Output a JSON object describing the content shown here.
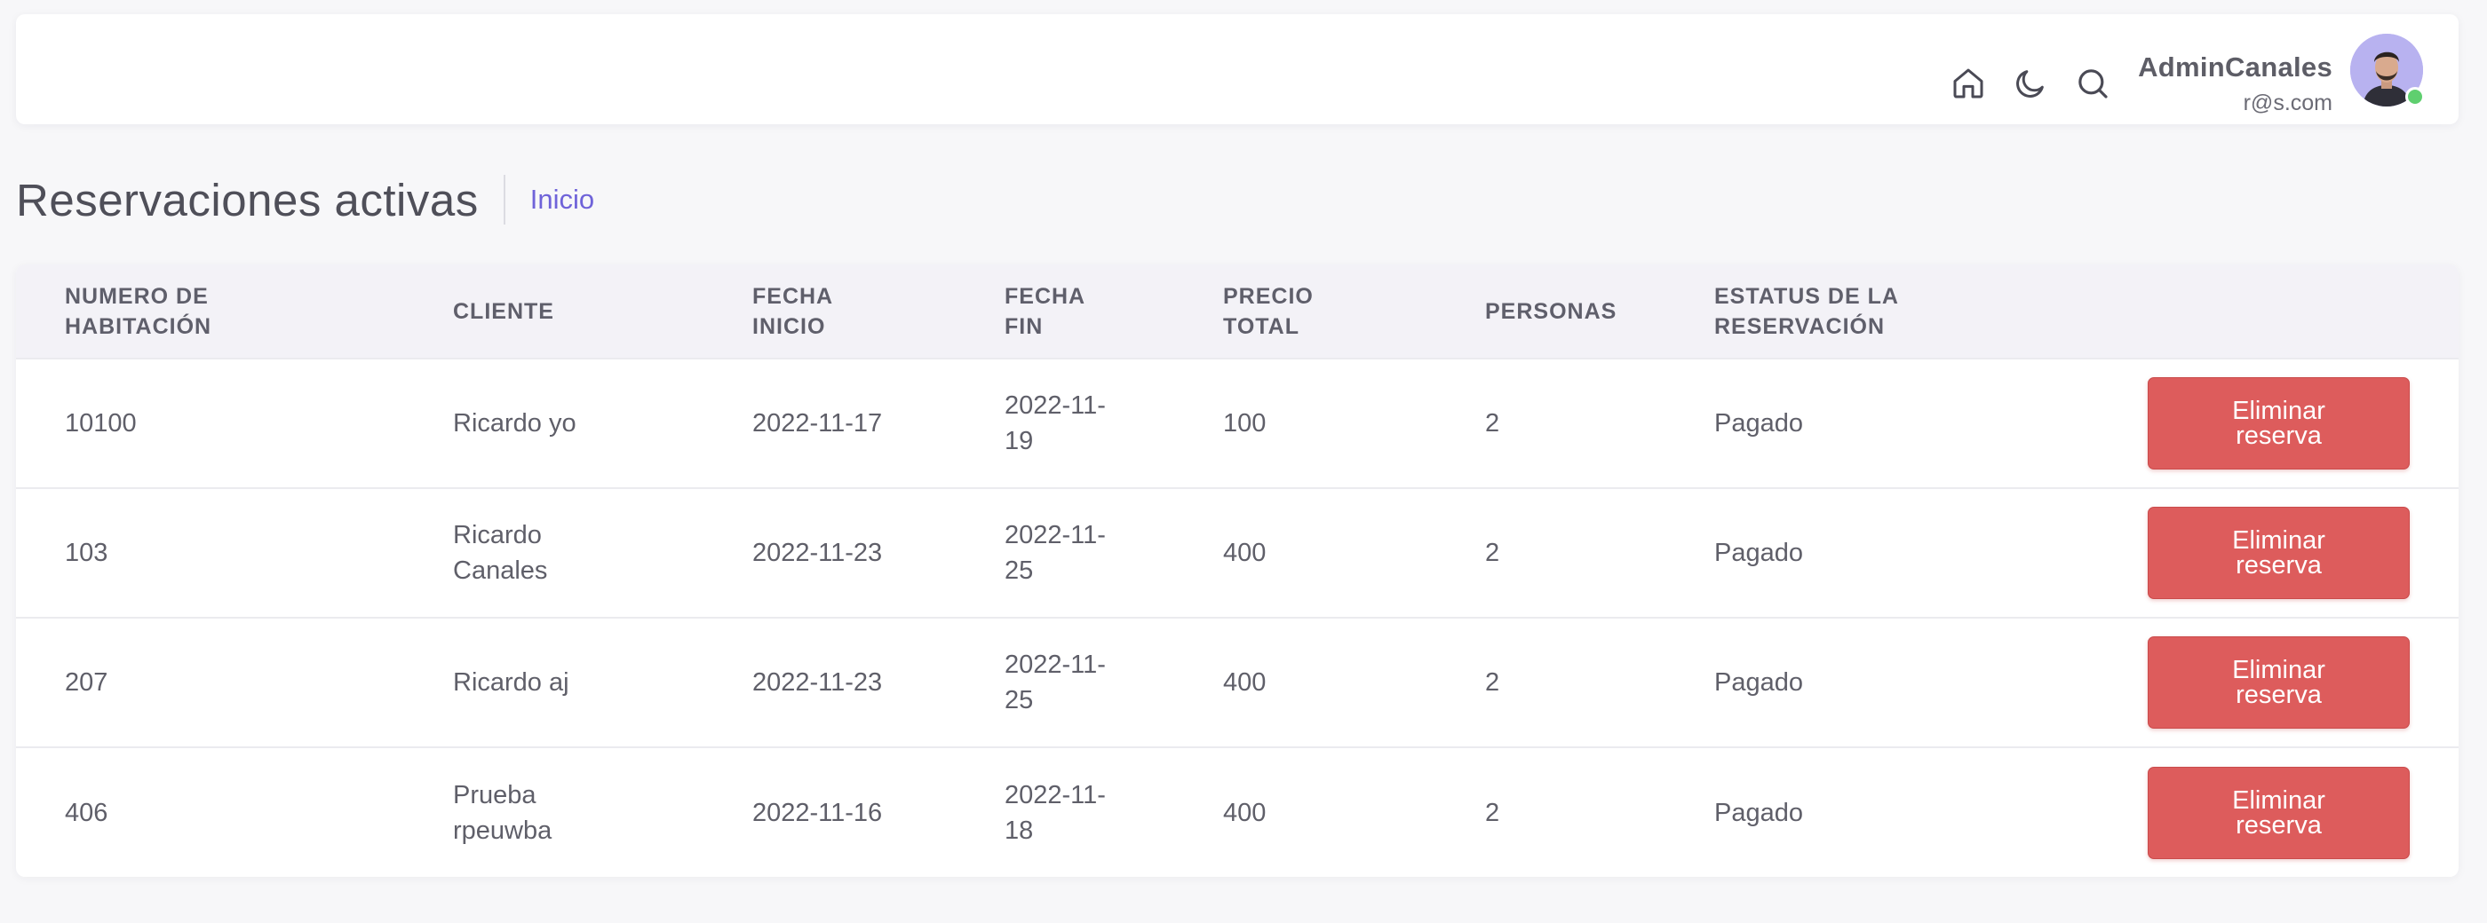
{
  "header": {
    "icons": [
      "home-icon",
      "moon-icon",
      "search-icon"
    ],
    "user_name": "AdminCanales",
    "user_email": "r@s.com",
    "status_color": "#5fcf6f"
  },
  "page": {
    "title": "Reservaciones activas",
    "breadcrumb": "Inicio"
  },
  "table": {
    "headers": [
      [
        "NUMERO DE",
        "HABITACIÓN"
      ],
      [
        "CLIENTE",
        ""
      ],
      [
        "FECHA",
        "INICIO"
      ],
      [
        "FECHA",
        "FIN"
      ],
      [
        "PRECIO",
        "TOTAL"
      ],
      [
        "PERSONAS",
        ""
      ],
      [
        "ESTATUS DE LA",
        "RESERVACIÓN"
      ]
    ],
    "action_label": "Eliminar reserva",
    "rows": [
      {
        "room": "10100",
        "client": "Ricardo yo",
        "start": "2022-11-17",
        "end": "2022-11-19",
        "price": "100",
        "people": "2",
        "status": "Pagado"
      },
      {
        "room": "103",
        "client": "Ricardo Canales",
        "start": "2022-11-23",
        "end": "2022-11-25",
        "price": "400",
        "people": "2",
        "status": "Pagado"
      },
      {
        "room": "207",
        "client": "Ricardo aj",
        "start": "2022-11-23",
        "end": "2022-11-25",
        "price": "400",
        "people": "2",
        "status": "Pagado"
      },
      {
        "room": "406",
        "client": "Prueba rpeuwba",
        "start": "2022-11-16",
        "end": "2022-11-18",
        "price": "400",
        "people": "2",
        "status": "Pagado"
      }
    ]
  },
  "colors": {
    "accent": "#6f63d9",
    "danger": "#dd5c5c"
  }
}
